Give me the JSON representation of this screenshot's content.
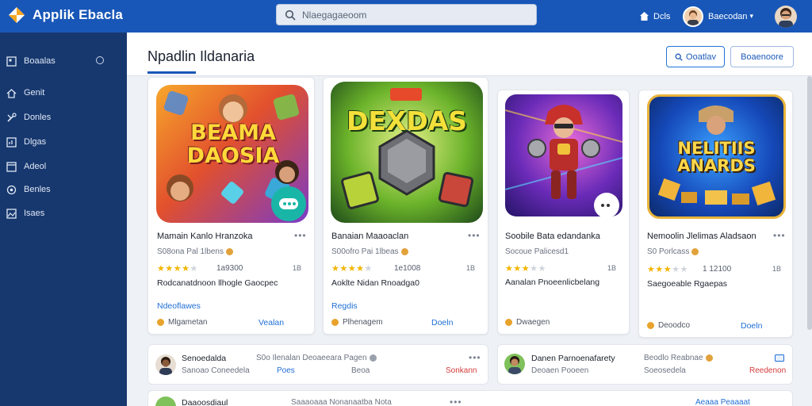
{
  "app": {
    "title": "Applik Ebacla"
  },
  "search": {
    "placeholder": "Nlaegagaeoom"
  },
  "topbar": {
    "home_label": "Dcls",
    "user_name": "Baecodan"
  },
  "sidebar": {
    "items": [
      {
        "label": "Boaalas",
        "icon": "grid-icon"
      },
      {
        "label": "Genit",
        "icon": "home-icon"
      },
      {
        "label": "Donles",
        "icon": "tools-icon"
      },
      {
        "label": "Dlgas",
        "icon": "chart-icon"
      },
      {
        "label": "Adeol",
        "icon": "window-icon"
      },
      {
        "label": "Benles",
        "icon": "gear-icon"
      },
      {
        "label": "Isaes",
        "icon": "image-icon"
      }
    ]
  },
  "header": {
    "title": "Npadlin Ildanaria",
    "button_primary": "Ooatlav",
    "button_secondary": "Boaenoore"
  },
  "cards": [
    {
      "art_title_line1": "BEAMA",
      "art_title_line2": "DAOSIA",
      "name": "Mamain Kanlo Hranzoka",
      "sub": "S08ona Pal 1lbens",
      "rating": 4,
      "rating_text": "1a9300",
      "size": "1B",
      "desc": "Rodcanatdnoon llhogle Gaocpec",
      "link": "Ndeoflawes",
      "foot": "Mlgametan",
      "action": "Vealan"
    },
    {
      "art_title_line1": "DEXDAS",
      "art_title_line2": "",
      "name": "Banaian Maaoaclan",
      "sub": "S00ofro Pai 1lbeas",
      "rating": 4,
      "rating_text": "1e1008",
      "size": "1B",
      "desc": "Aoklte Nidan Rnoadga0",
      "link": "Regdis",
      "foot": "Plhenagem",
      "action": "Doeln"
    },
    {
      "art_title_line1": "",
      "art_title_line2": "",
      "name": "Soobile Bata edandanka",
      "sub": "Socoue Palicesd1",
      "rating": 3,
      "rating_text": "",
      "size": "1B",
      "desc": "Aanalan Pnoeenlicbelang",
      "link": "",
      "foot": "Dwaegen",
      "action": ""
    },
    {
      "art_title_line1": "NELITIIS",
      "art_title_line2": "ANARDS",
      "name": "Nemoolin Jlelimas Aladsaon",
      "sub": "S0 Porlcass",
      "rating": 3,
      "rating_text": "1 12100",
      "size": "1B",
      "desc": "Saegoeable Rgaepas",
      "link": "",
      "foot": "Deoodco",
      "action": "Doeln"
    }
  ],
  "rows": [
    {
      "name": "Senoedalda",
      "sub": "Sanoao Coneedela",
      "mid_top": "S0o Ilenalan Deoaeeara Pagen",
      "mid_blue": "Poes",
      "mid_gray": "Beoa",
      "red": "Sonkann"
    },
    {
      "name": "Danen Parnoenafarety",
      "sub": "Deoaen Pooeen",
      "mid_top": "Beodlo Reabnae",
      "mid_gray": "Soeosedela",
      "red": "Reedenon"
    },
    {
      "name": "Daaoosdiaul",
      "mid_top": "Saaaoaaa Nonanaatba Nota",
      "blue_right": "Aeaaa Peaaaat"
    }
  ],
  "colors": {
    "topbar": "#1857b8",
    "sidebar": "#17386e",
    "accent": "#1f6fd6",
    "danger": "#d63b3b",
    "star": "#f4b400"
  }
}
